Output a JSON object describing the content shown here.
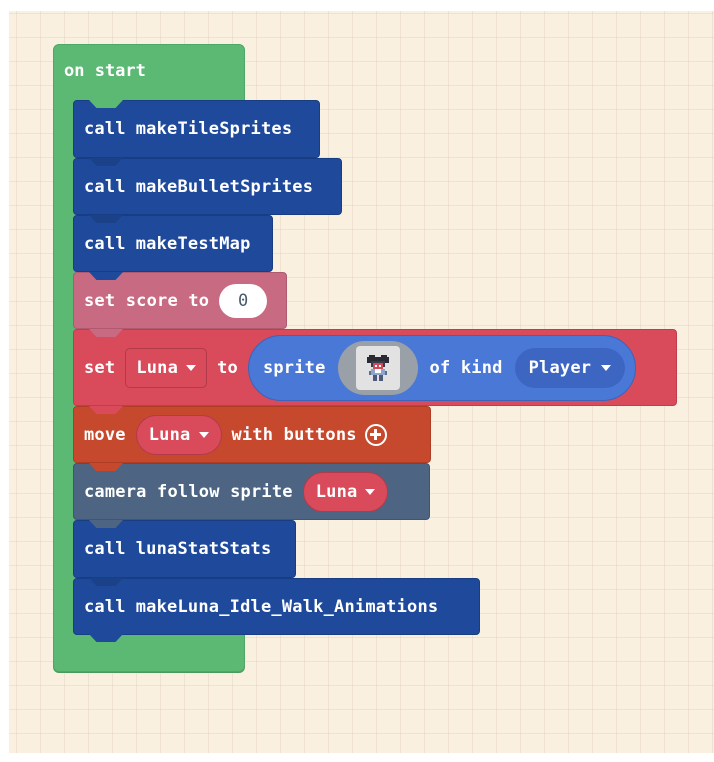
{
  "workspace": {
    "hat_block": {
      "label": "on start",
      "color": "#5cb974"
    },
    "blocks": [
      {
        "type": "call",
        "keyword": "call",
        "name": "makeTileSprites",
        "color": "#1f4a9b"
      },
      {
        "type": "call",
        "keyword": "call",
        "name": "makeBulletSprites",
        "color": "#1f4a9b"
      },
      {
        "type": "call",
        "keyword": "call",
        "name": "makeTestMap",
        "color": "#1f4a9b"
      },
      {
        "type": "set-var",
        "prefix": "set score to",
        "value": "0",
        "color": "#c76a82"
      },
      {
        "type": "set-sprite",
        "set_label": "set",
        "variable": "Luna",
        "to_label": "to",
        "sprite_label": "sprite",
        "image_icon": "sprite-image-luna",
        "of_kind_label": "of kind",
        "kind": "Player",
        "color": "#d94a5b",
        "expr_color": "#4a78d6"
      },
      {
        "type": "move",
        "prefix": "move",
        "sprite": "Luna",
        "suffix": "with buttons",
        "expand_icon": "plus-circle-icon",
        "color": "#c6492e"
      },
      {
        "type": "camera",
        "prefix": "camera follow sprite",
        "sprite": "Luna",
        "color": "#4d6582"
      },
      {
        "type": "call",
        "keyword": "call",
        "name": "lunaStatStats",
        "color": "#1f4a9b"
      },
      {
        "type": "call",
        "keyword": "call",
        "name": "makeLuna_Idle_Walk_Animations",
        "color": "#1f4a9b"
      }
    ]
  }
}
